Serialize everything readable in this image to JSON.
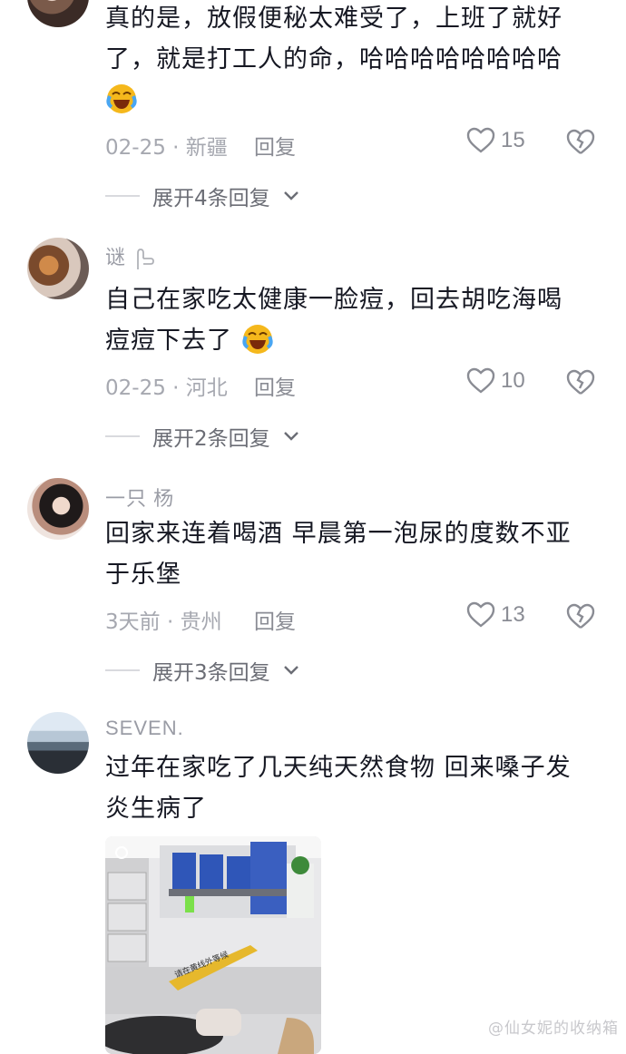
{
  "comments": [
    {
      "username": "",
      "text_lines": [
        "真的是，放假便秘太难受了，上班了就好",
        "了，就是打工人的命，哈哈哈哈哈哈哈哈"
      ],
      "date": "02-25",
      "location": "新疆",
      "reply_label": "回复",
      "likes": "15",
      "expand_label": "展开4条回复"
    },
    {
      "username": "谜",
      "text_lines": [
        "自己在家吃太健康一脸痘，回去胡吃海喝",
        "痘痘下去了"
      ],
      "date": "02-25",
      "location": "河北",
      "reply_label": "回复",
      "likes": "10",
      "expand_label": "展开2条回复"
    },
    {
      "username": "一只 杨",
      "text_lines": [
        "回家来连着喝酒  早晨第一泡尿的度数不亚",
        "于乐堡"
      ],
      "date": "3天前",
      "location": "贵州",
      "reply_label": "回复",
      "likes": "13",
      "expand_label": "展开3条回复"
    },
    {
      "username": "SEVEN.",
      "text_lines": [
        "过年在家吃了几天纯天然食物  回来嗓子发",
        "炎生病了"
      ]
    }
  ],
  "separator": "·",
  "photo_signs": {
    "floor": "请在黄线外等候"
  },
  "watermark": "@仙女妮的收纳箱",
  "colors": {
    "text": "#161823",
    "meta": "#a6a8b0",
    "accent_emoji": "#f5b81c"
  }
}
